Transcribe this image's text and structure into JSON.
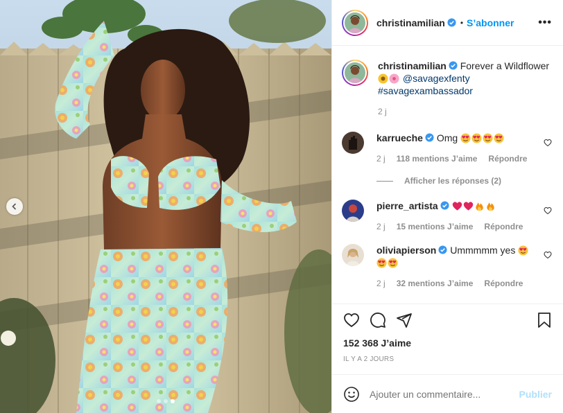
{
  "post": {
    "author": "christinamilian",
    "follow_label": "S’abonner",
    "bullet": "•",
    "more_label": "•••",
    "carousel": {
      "slides": 3,
      "active_index": 2
    }
  },
  "caption": {
    "username": "christinamilian",
    "text": "Forever a Wildflower",
    "mention": "@savagexfenty",
    "hashtag": "#savagexambassador",
    "time": "2 j",
    "emojis": [
      "sunflower",
      "cherry-blossom"
    ]
  },
  "comments": [
    {
      "username": "karrueche",
      "text": "Omg",
      "emojis": [
        "heart-eyes",
        "heart-eyes",
        "heart-eyes",
        "heart-eyes"
      ],
      "time": "2 j",
      "likes": "118 mentions J’aime",
      "reply": "Répondre",
      "view_replies": "Afficher les réponses (2)"
    },
    {
      "username": "pierre_artista",
      "text": "",
      "emojis": [
        "red-heart",
        "red-heart",
        "fire",
        "fire"
      ],
      "time": "2 j",
      "likes": "15 mentions J’aime",
      "reply": "Répondre"
    },
    {
      "username": "oliviapierson",
      "text": "Ummmmm yes",
      "emojis": [
        "heart-eyes",
        "heart-eyes",
        "heart-eyes"
      ],
      "time": "2 j",
      "likes": "32 mentions J’aime",
      "reply": "Répondre"
    }
  ],
  "actions": {
    "likes": "152 368 J’aime",
    "ago": "IL Y A 2 JOURS"
  },
  "composer": {
    "placeholder": "Ajouter un commentaire...",
    "post_label": "Publier"
  },
  "colors": {
    "accent": "#0095f6",
    "verified": "#3897f0",
    "post_disabled": "#b2dffc"
  }
}
